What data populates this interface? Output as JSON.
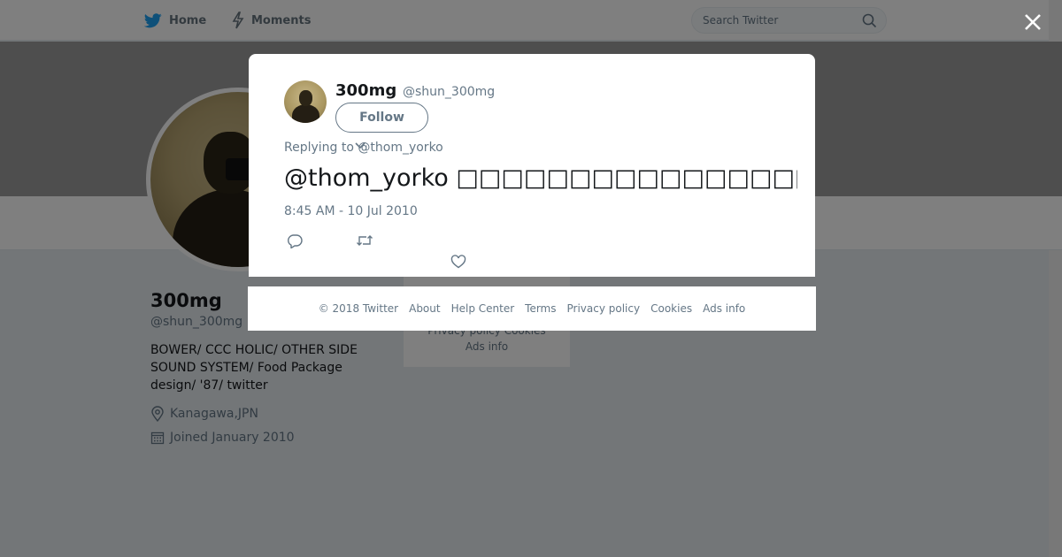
{
  "nav": {
    "home_label": "Home",
    "moments_label": "Moments",
    "search_placeholder": "Search Twitter"
  },
  "profile": {
    "name": "300mg",
    "handle": "@shun_300mg",
    "bio": "BOWER/ CCC HOLIC/ OTHER SIDE SOUND SYSTEM/ Food Package design/ '87/ twitter",
    "location": "Kanagawa,JPN",
    "joined": "Joined January 2010"
  },
  "side_card": {
    "links_line1": "Privacy policy   Cookies",
    "links_line2": "Ads info"
  },
  "tweet": {
    "author_name": "300mg",
    "author_handle": "@shun_300mg",
    "follow_label": "Follow",
    "replying_prefix": "Replying to",
    "replying_to": "@thom_yorko",
    "text_mention": "@thom_yorko",
    "text_body": "□□□□□□□□□□□□□□□□□□□□□□□□□",
    "timestamp": "8:45 AM - 10 Jul 2010"
  },
  "footer": {
    "copyright": "© 2018 Twitter",
    "links": [
      "About",
      "Help Center",
      "Terms",
      "Privacy policy",
      "Cookies",
      "Ads info"
    ]
  },
  "colors": {
    "twitter_blue": "#1da1f2",
    "secondary_text": "#657786",
    "overlay": "rgba(0,0,0,0.5)"
  },
  "icons": {
    "home": "twitter-bird-icon",
    "moments": "lightning-icon",
    "search": "search-icon",
    "close": "close-icon",
    "location": "location-pin-icon",
    "joined": "calendar-icon",
    "reply": "reply-icon",
    "retweet": "retweet-icon",
    "like": "heart-icon"
  }
}
